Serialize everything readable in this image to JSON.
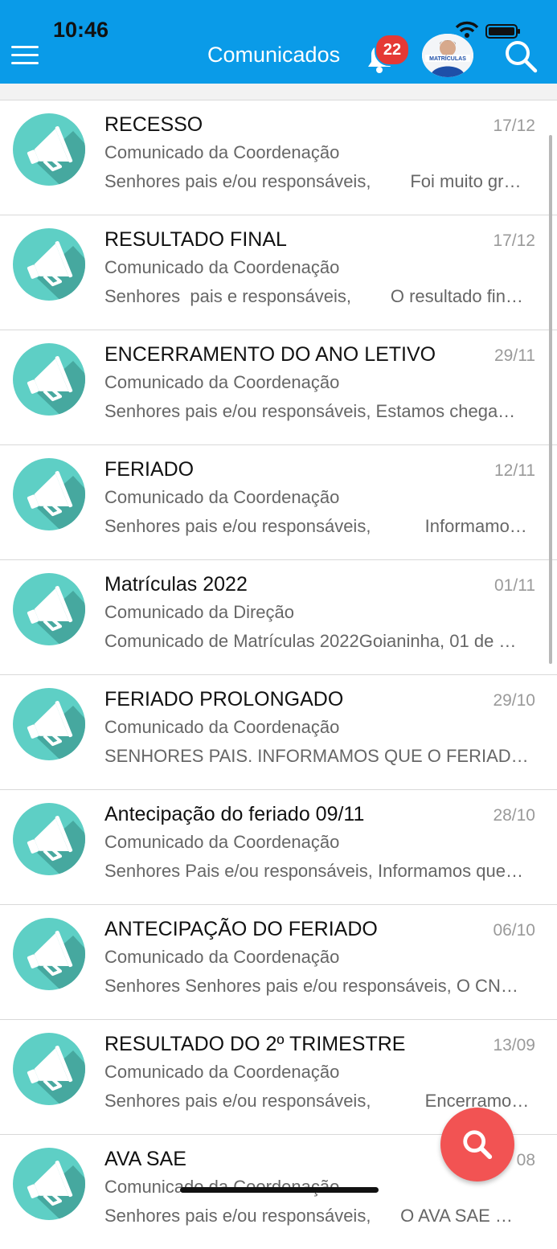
{
  "status_bar": {
    "time": "10:46"
  },
  "header": {
    "title": "Comunicados",
    "notification_count": "22",
    "avatar_text": "MATRÍCULAS",
    "brand_color": "#0a9be8"
  },
  "messages": [
    {
      "subject": "RECESSO",
      "date": "17/12",
      "sender": "Comunicado da Coordenação",
      "preview": "Senhores pais e/ou responsáveis,        Foi muito gr…"
    },
    {
      "subject": "RESULTADO FINAL",
      "date": "17/12",
      "sender": "Comunicado da Coordenação",
      "preview": "Senhores  pais e responsáveis,        O resultado fin…"
    },
    {
      "subject": "ENCERRAMENTO DO ANO LETIVO",
      "date": "29/11",
      "sender": "Comunicado da Coordenação",
      "preview": "Senhores pais e/ou responsáveis, Estamos chega…"
    },
    {
      "subject": "FERIADO",
      "date": "12/11",
      "sender": "Comunicado da Coordenação",
      "preview": "Senhores pais e/ou responsáveis,           Informamo…"
    },
    {
      "subject": "Matrículas 2022",
      "date": "01/11",
      "sender": "Comunicado da Direção",
      "preview": "Comunicado de Matrículas 2022Goianinha, 01 de …"
    },
    {
      "subject": "FERIADO PROLONGADO",
      "date": "29/10",
      "sender": "Comunicado da Coordenação",
      "preview": "SENHORES PAIS. INFORMAMOS QUE O FERIAD…"
    },
    {
      "subject": "Antecipação do feriado 09/11",
      "date": "28/10",
      "sender": "Comunicado da Coordenação",
      "preview": "Senhores Pais e/ou responsáveis, Informamos que…"
    },
    {
      "subject": "ANTECIPAÇÃO DO FERIADO",
      "date": "06/10",
      "sender": "Comunicado da Coordenação",
      "preview": "Senhores Senhores pais e/ou responsáveis, O CN…"
    },
    {
      "subject": "RESULTADO DO 2º TRIMESTRE",
      "date": "13/09",
      "sender": "Comunicado da Coordenação",
      "preview": "Senhores pais e/ou responsáveis,           Encerramo…"
    },
    {
      "subject": "AVA SAE",
      "date": "08",
      "sender": "Comunicado da Coordenação",
      "preview": "Senhores pais e/ou responsáveis,      O AVA SAE …"
    }
  ],
  "icons": {
    "menu": "menu-icon",
    "bell": "bell-icon",
    "search": "search-icon",
    "megaphone": "megaphone-icon"
  },
  "colors": {
    "icon_circle": "#5ecfc5",
    "icon_shadow": "#46a89f",
    "fab": "#f25353"
  }
}
